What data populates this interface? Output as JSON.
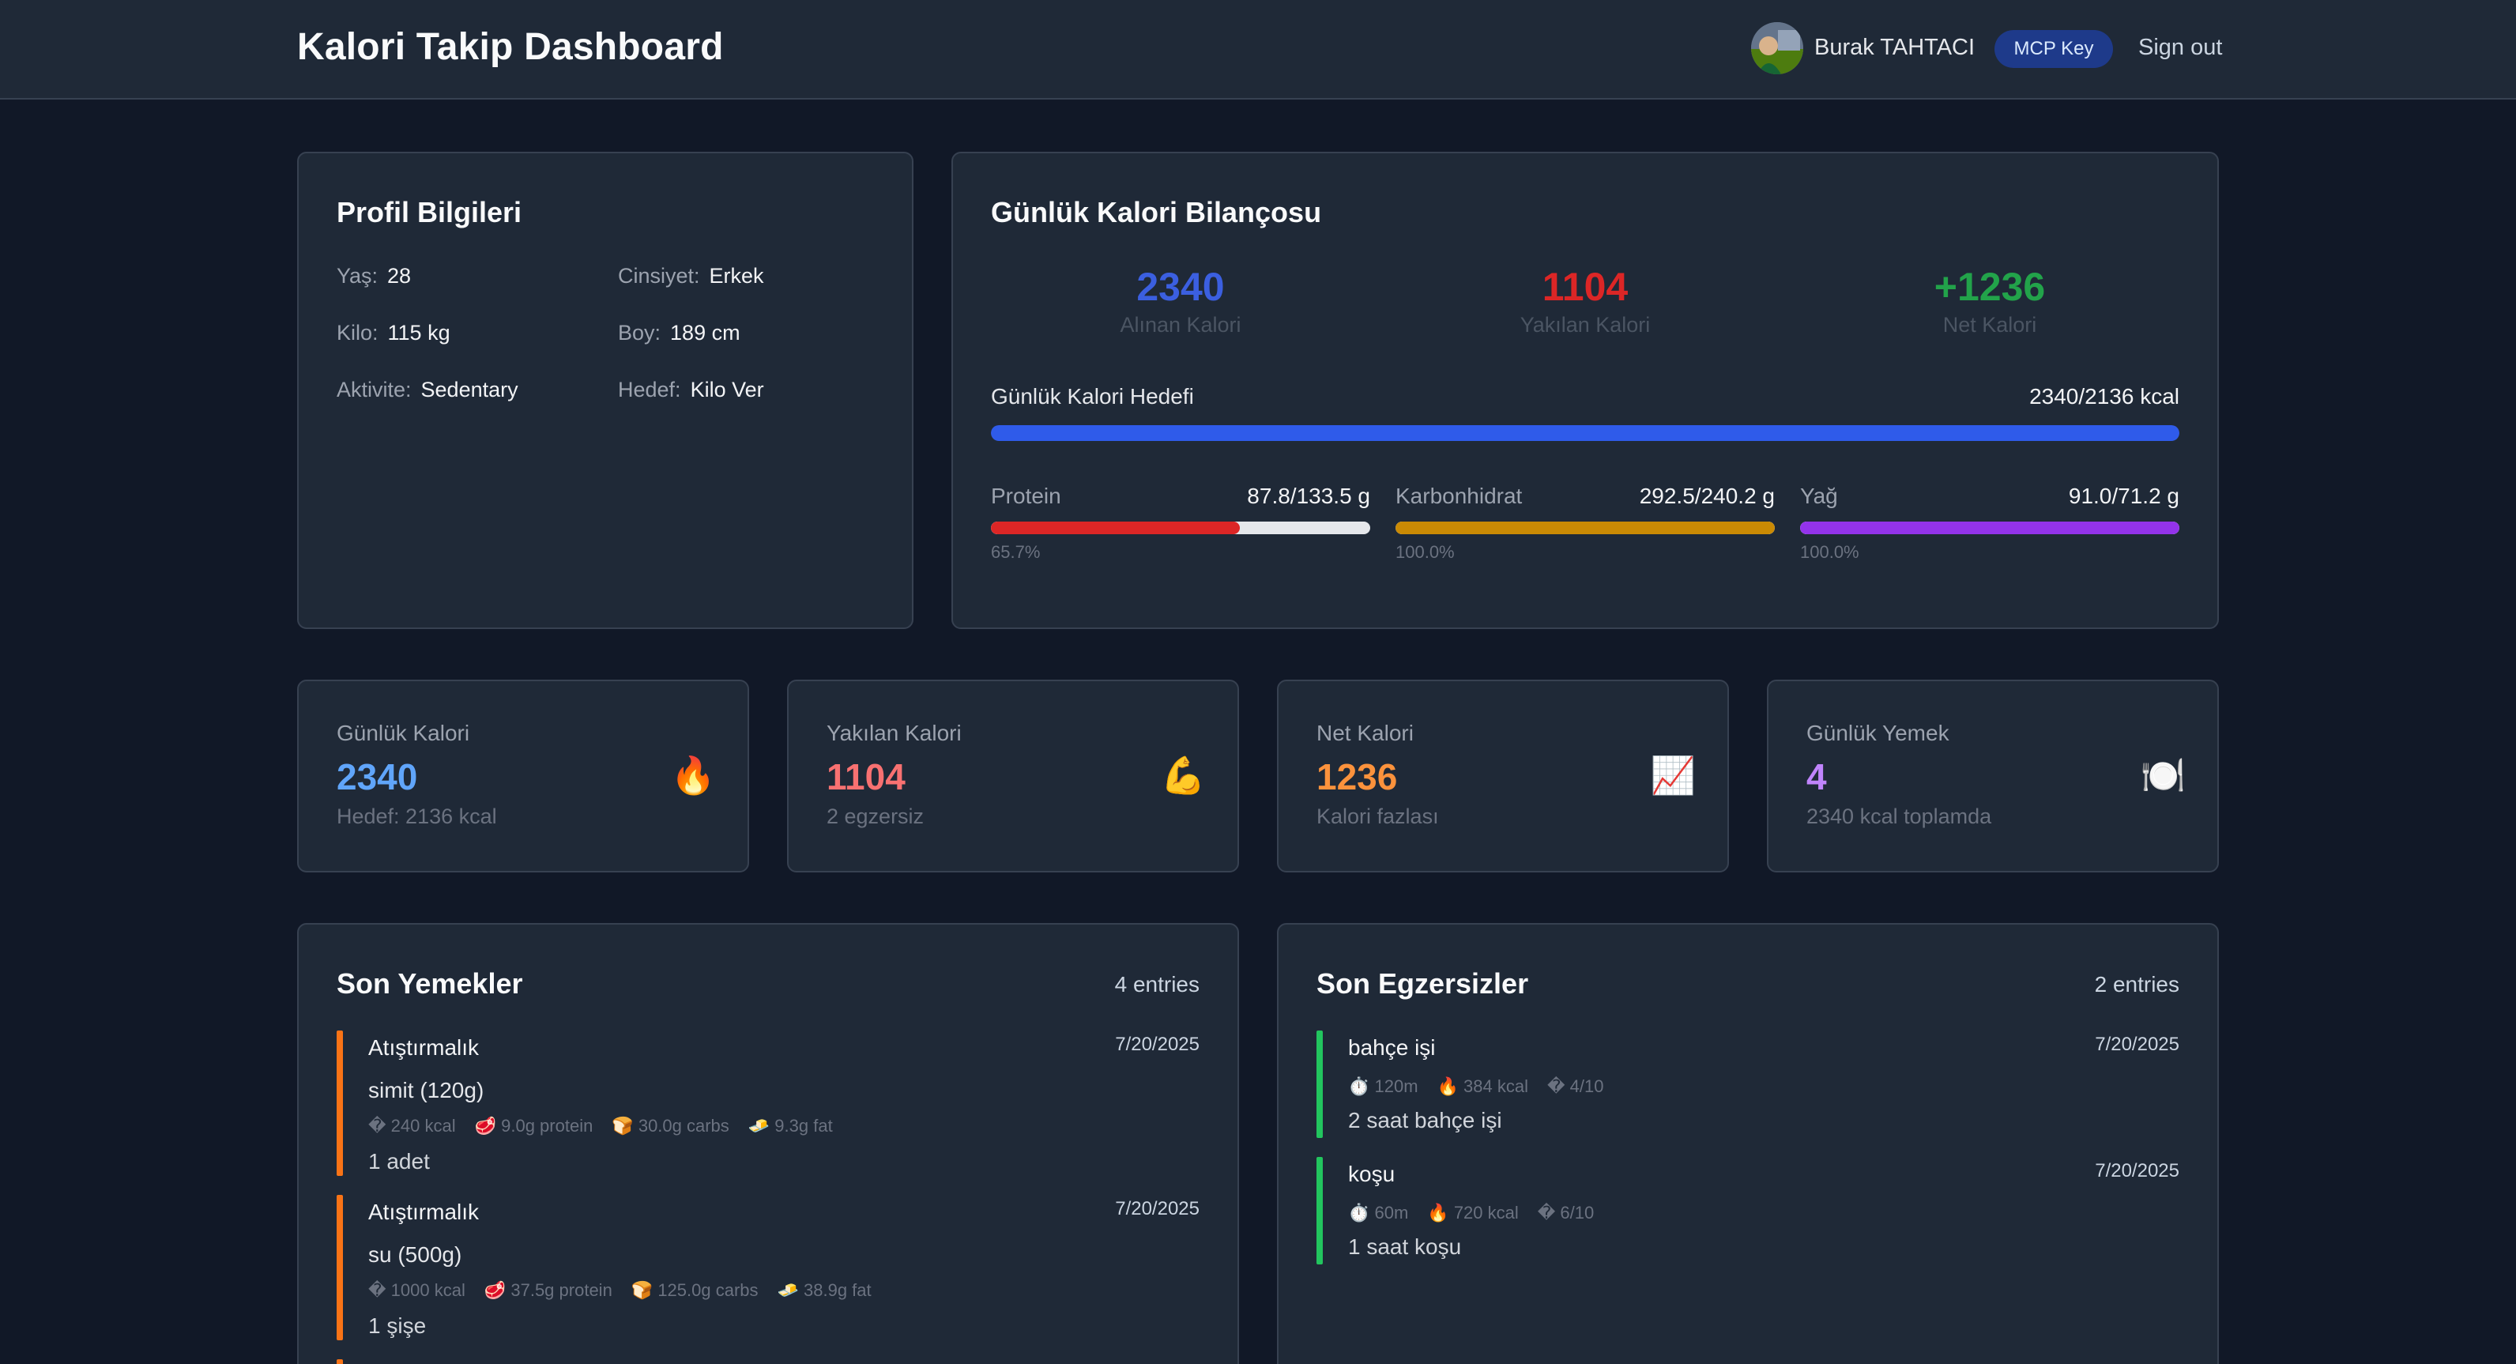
{
  "header": {
    "title": "Kalori Takip Dashboard",
    "user_name": "Burak TAHTACI",
    "mcp_label": "MCP Key",
    "signout_label": "Sign out"
  },
  "profile": {
    "title": "Profil Bilgileri",
    "age_label": "Yaş:",
    "age": "28",
    "gender_label": "Cinsiyet:",
    "gender": "Erkek",
    "weight_label": "Kilo:",
    "weight": "115 kg",
    "height_label": "Boy:",
    "height": "189 cm",
    "activity_label": "Aktivite:",
    "activity": "Sedentary",
    "goal_label": "Hedef:",
    "goal": "Kilo Ver"
  },
  "balance": {
    "title": "Günlük Kalori Bilançosu",
    "consumed": "2340",
    "consumed_label": "Alınan Kalori",
    "burned": "1104",
    "burned_label": "Yakılan Kalori",
    "net": "+1236",
    "net_label": "Net Kalori",
    "goal_label": "Günlük Kalori Hedefi",
    "goal_value": "2340/2136 kcal",
    "goal_progress": 1.0,
    "macros": [
      {
        "name": "Protein",
        "value": "87.8/133.5 g",
        "percent": "65.7%",
        "fraction": 0.657,
        "color": "#dc2626"
      },
      {
        "name": "Karbonhidrat",
        "value": "292.5/240.2 g",
        "percent": "100.0%",
        "fraction": 1.0,
        "color": "#ca8a04"
      },
      {
        "name": "Yağ",
        "value": "91.0/71.2 g",
        "percent": "100.0%",
        "fraction": 1.0,
        "color": "#9333ea"
      }
    ]
  },
  "stats": [
    {
      "label": "Günlük Kalori",
      "value": "2340",
      "sub": "Hedef: 2136 kcal",
      "icon": "🔥",
      "icon_name": "fire-icon",
      "color": "#60a5fa"
    },
    {
      "label": "Yakılan Kalori",
      "value": "1104",
      "sub": "2 egzersiz",
      "icon": "💪",
      "icon_name": "flexed-biceps-icon",
      "color": "#f87171"
    },
    {
      "label": "Net Kalori",
      "value": "1236",
      "sub": "Kalori fazlası",
      "icon": "📈",
      "icon_name": "chart-increasing-icon",
      "color": "#fb923c"
    },
    {
      "label": "Günlük Yemek",
      "value": "4",
      "sub": "2340 kcal toplamda",
      "icon": "🍽️",
      "icon_name": "plate-icon",
      "color": "#c084fc"
    }
  ],
  "meals": {
    "title": "Son Yemekler",
    "count": "4 entries",
    "items": [
      {
        "type": "Atıştırmalık",
        "date": "7/20/2025",
        "food": "simit (120g)",
        "kcal": "� 240 kcal",
        "protein": "🥩 9.0g protein",
        "carbs": "🍞 30.0g carbs",
        "fat": "🧈 9.3g fat",
        "note": "1 adet"
      },
      {
        "type": "Atıştırmalık",
        "date": "7/20/2025",
        "food": "su (500g)",
        "kcal": "� 1000 kcal",
        "protein": "🥩 37.5g protein",
        "carbs": "🍞 125.0g carbs",
        "fat": "🧈 38.9g fat",
        "note": "1 şişe"
      }
    ]
  },
  "exercises": {
    "title": "Son Egzersizler",
    "count": "2 entries",
    "items": [
      {
        "name": "bahçe işi",
        "date": "7/20/2025",
        "duration": "⏱️ 120m",
        "kcal": "🔥 384 kcal",
        "intensity": "� 4/10",
        "note": "2 saat bahçe işi"
      },
      {
        "name": "koşu",
        "date": "7/20/2025",
        "duration": "⏱️ 60m",
        "kcal": "🔥 720 kcal",
        "intensity": "� 6/10",
        "note": "1 saat koşu"
      }
    ]
  }
}
